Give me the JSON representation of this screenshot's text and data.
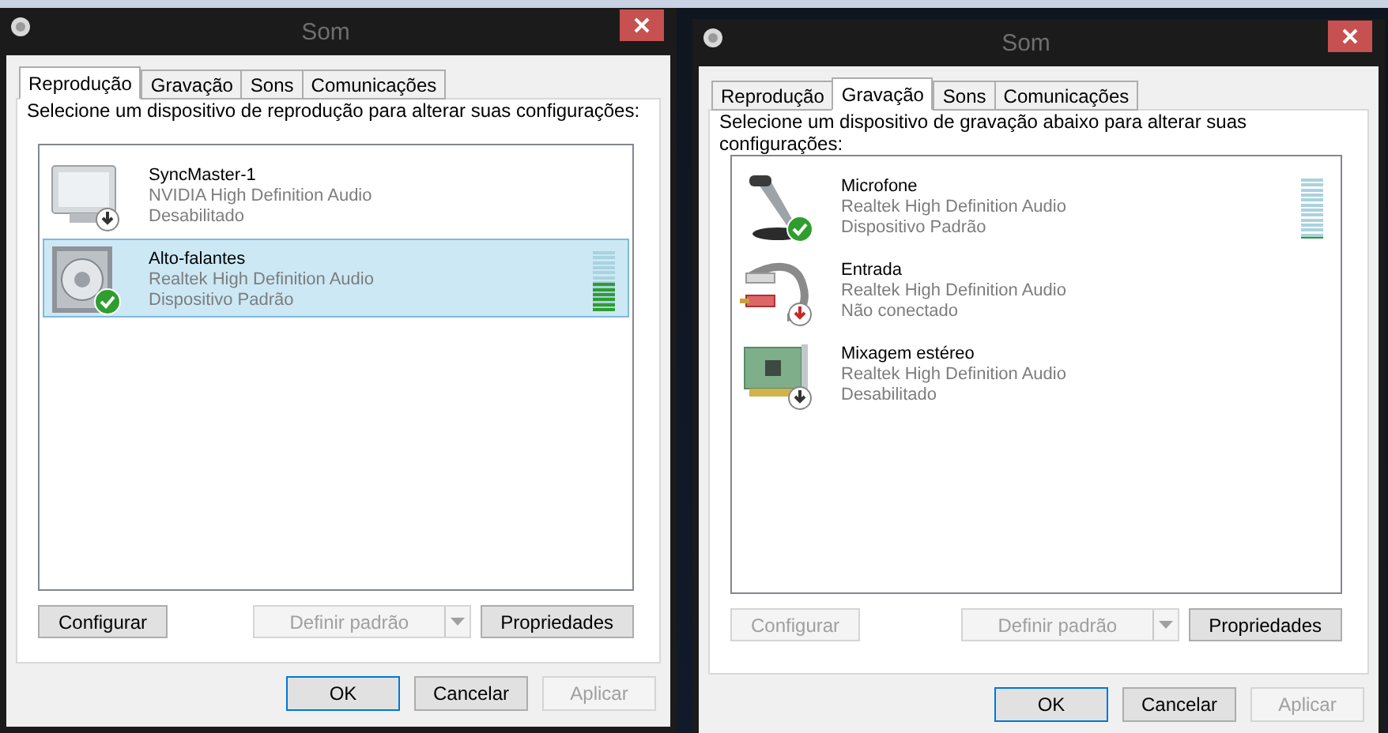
{
  "windows": [
    {
      "title": "Som",
      "tabs": [
        {
          "label": "Reprodução",
          "selected": true
        },
        {
          "label": "Gravação",
          "selected": false
        },
        {
          "label": "Sons",
          "selected": false
        },
        {
          "label": "Comunicações",
          "selected": false
        }
      ],
      "instruction": "Selecione um dispositivo de reprodução para alterar suas configurações:",
      "devices": [
        {
          "kind": "monitor",
          "default": false,
          "disabled": true,
          "unplugged": false,
          "name": "SyncMaster-1",
          "driver": "NVIDIA High Definition Audio",
          "status": "Desabilitado",
          "selected": false
        },
        {
          "kind": "speaker",
          "default": true,
          "disabled": false,
          "unplugged": false,
          "name": "Alto-falantes",
          "driver": "Realtek High Definition Audio",
          "status": "Dispositivo Padrão",
          "selected": true,
          "level": 0.5
        }
      ],
      "buttons": [
        {
          "label": "Configurar",
          "disabled": false,
          "kind": "plain"
        },
        {
          "label": "Definir padrão",
          "disabled": true,
          "kind": "split"
        },
        {
          "label": "Propriedades",
          "disabled": false,
          "kind": "plain"
        }
      ],
      "dialog_buttons": [
        {
          "label": "OK",
          "disabled": false,
          "focused": true
        },
        {
          "label": "Cancelar",
          "disabled": false,
          "focused": false
        },
        {
          "label": "Aplicar",
          "disabled": true,
          "focused": false
        }
      ]
    },
    {
      "title": "Som",
      "tabs": [
        {
          "label": "Reprodução",
          "selected": false
        },
        {
          "label": "Gravação",
          "selected": true
        },
        {
          "label": "Sons",
          "selected": false
        },
        {
          "label": "Comunicações",
          "selected": false
        }
      ],
      "instruction": "Selecione um dispositivo de gravação abaixo para alterar suas configurações:",
      "devices": [
        {
          "kind": "microphone",
          "default": true,
          "disabled": false,
          "unplugged": false,
          "name": "Microfone",
          "driver": "Realtek High Definition Audio",
          "status": "Dispositivo Padrão",
          "selected": false,
          "level": 0
        },
        {
          "kind": "jack",
          "default": false,
          "disabled": false,
          "unplugged": true,
          "name": "Entrada",
          "driver": "Realtek High Definition Audio",
          "status": "Não conectado",
          "selected": false
        },
        {
          "kind": "card",
          "default": false,
          "disabled": true,
          "unplugged": false,
          "name": "Mixagem estéreo",
          "driver": "Realtek High Definition Audio",
          "status": "Desabilitado",
          "selected": false
        }
      ],
      "buttons": [
        {
          "label": "Configurar",
          "disabled": true,
          "kind": "plain"
        },
        {
          "label": "Definir padrão",
          "disabled": true,
          "kind": "split"
        },
        {
          "label": "Propriedades",
          "disabled": false,
          "kind": "plain"
        }
      ],
      "dialog_buttons": [
        {
          "label": "OK",
          "disabled": false,
          "focused": true
        },
        {
          "label": "Cancelar",
          "disabled": false,
          "focused": false
        },
        {
          "label": "Aplicar",
          "disabled": true,
          "focused": false
        }
      ]
    }
  ]
}
